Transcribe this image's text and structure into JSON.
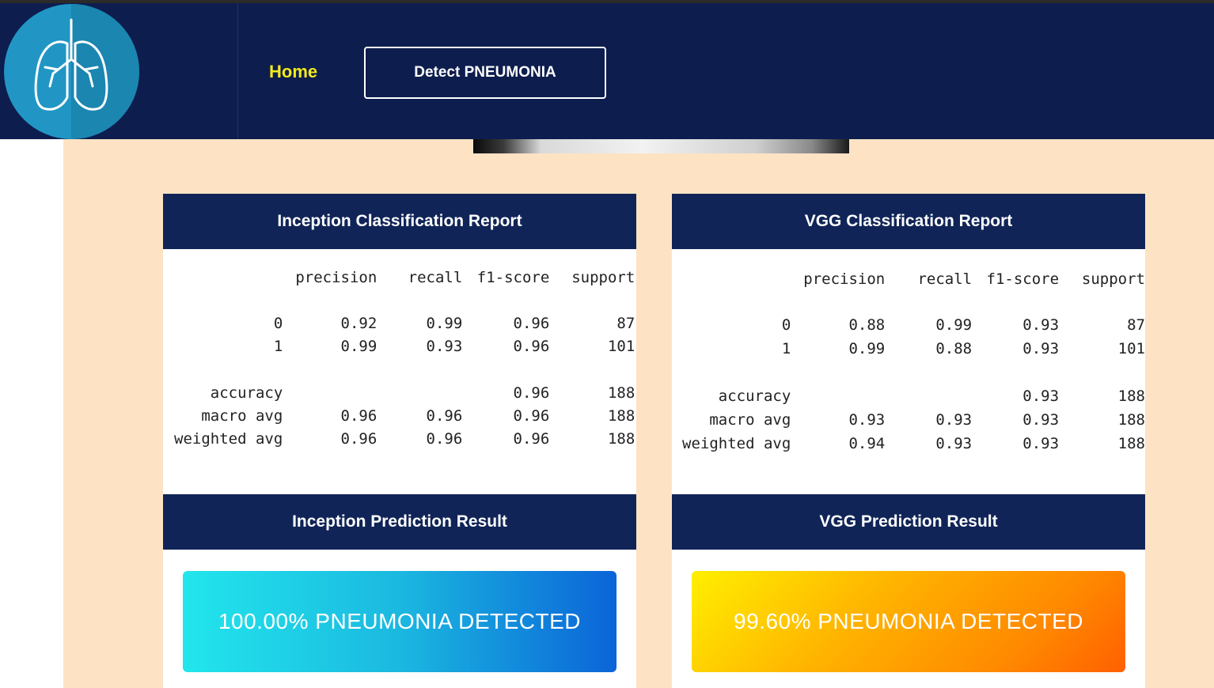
{
  "nav": {
    "home_label": "Home",
    "detect_label": "Detect PNEUMONIA"
  },
  "logo": {
    "icon": "lungs-icon"
  },
  "colors": {
    "navbar": "#0d1d4e",
    "card_header": "#102457",
    "page_bg": "#fde3c4",
    "home_link": "#f2ea1c"
  },
  "inception": {
    "report_title": "Inception Classification Report",
    "result_title": "Inception Prediction Result",
    "result_text": "100.00% PNEUMONIA DETECTED",
    "report": {
      "headers": [
        "",
        "precision",
        "recall",
        "f1-score",
        "support"
      ],
      "rows": [
        [
          "0",
          "0.92",
          "0.99",
          "0.96",
          "87"
        ],
        [
          "1",
          "0.99",
          "0.93",
          "0.96",
          "101"
        ],
        [
          "accuracy",
          "",
          "",
          "0.96",
          "188"
        ],
        [
          "macro avg",
          "0.96",
          "0.96",
          "0.96",
          "188"
        ],
        [
          "weighted avg",
          "0.96",
          "0.96",
          "0.96",
          "188"
        ]
      ]
    }
  },
  "vgg": {
    "report_title": "VGG Classification Report",
    "result_title": "VGG Prediction Result",
    "result_text": "99.60% PNEUMONIA DETECTED",
    "report": {
      "headers": [
        "",
        "precision",
        "recall",
        "f1-score",
        "support"
      ],
      "rows": [
        [
          "0",
          "0.88",
          "0.99",
          "0.93",
          "87"
        ],
        [
          "1",
          "0.99",
          "0.88",
          "0.93",
          "101"
        ],
        [
          "accuracy",
          "",
          "",
          "0.93",
          "188"
        ],
        [
          "macro avg",
          "0.93",
          "0.93",
          "0.93",
          "188"
        ],
        [
          "weighted avg",
          "0.94",
          "0.93",
          "0.93",
          "188"
        ]
      ]
    }
  }
}
